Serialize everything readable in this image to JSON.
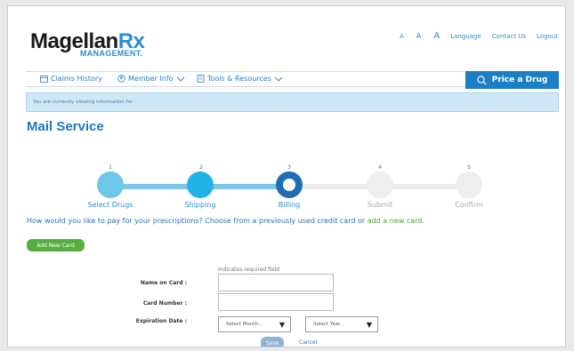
{
  "header": {
    "logo_main": "Magellan",
    "logo_rx": "Rx",
    "logo_sub": "MANAGEMENT.",
    "font_size_a1": "A",
    "font_size_a2": "A",
    "font_size_a3": "A",
    "language": "Language",
    "contact": "Contact Us",
    "logout": "Logout"
  },
  "nav": {
    "claims": "Claims History",
    "member": "Member Info",
    "tools": "Tools & Resources",
    "price": "Price a Drug"
  },
  "info_bar": "You are currently viewing information for :",
  "page_title": "Mail Service",
  "steps": [
    {
      "num": "1",
      "label": "Select Drugs"
    },
    {
      "num": "2",
      "label": "Shipping"
    },
    {
      "num": "3",
      "label": "Billing"
    },
    {
      "num": "4",
      "label": "Submit"
    },
    {
      "num": "5",
      "label": "Confirm"
    }
  ],
  "question": {
    "text": "How would you like to pay for your prescriptions? Choose from a previously used credit card or ",
    "link": "add a new card",
    "end": "."
  },
  "add_card": "Add New Card",
  "form": {
    "required_note": "Indicates required field",
    "name_label": "Name on Card :",
    "name_value": "",
    "number_label": "Card Number :",
    "number_value": "",
    "exp_label": "Expiration Date :",
    "month_placeholder": "Select Month...",
    "year_placeholder": "Select Year...",
    "save": "Save",
    "cancel": "Cancel"
  },
  "colors": {
    "brand_blue": "#1e78c2",
    "completed_step": "#6dc7e9",
    "active_step": "#1fb3e6",
    "current_step": "#1f6db5",
    "add_green": "#57ae3f"
  }
}
